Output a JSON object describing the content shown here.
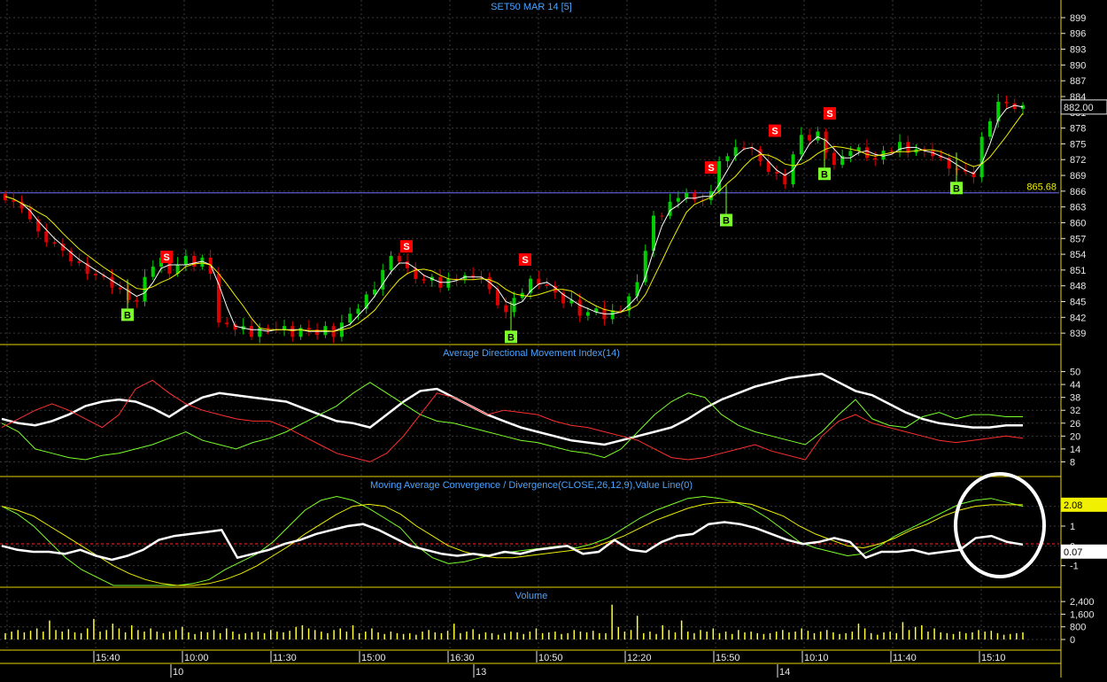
{
  "colors": {
    "background": "#000000",
    "grid": "#3a3a3a",
    "divider": "#e6d600",
    "axis_text": "#e8e8e8",
    "title_text": "#4aa3ff",
    "bull_candle": "#00d000",
    "bear_candle": "#e00000",
    "ma_white": "#ffffff",
    "ma_yellow": "#f0f000",
    "ref_line": "#6f6fff",
    "sell_marker": "#ff0000",
    "buy_marker": "#7cff2a",
    "zero_line": "#ff2a2a",
    "volume_bar": "#ffff33",
    "highlight_circle": "#ffffff"
  },
  "chart_data": [
    {
      "type": "candlestick",
      "title": "SET50 MAR 14   [5]",
      "ylim": [
        837,
        900
      ],
      "y_ticks": [
        "899",
        "896",
        "893",
        "890",
        "887",
        "884",
        "881",
        "878",
        "875",
        "872",
        "869",
        "866",
        "863",
        "860",
        "857",
        "854",
        "851",
        "848",
        "845",
        "842",
        "839"
      ],
      "last_price_label": "882.00",
      "reference_line": {
        "value": 865.68,
        "label": "865.68"
      },
      "series": [
        {
          "name": "price",
          "values": [
            865,
            864,
            862,
            861,
            858,
            857,
            856,
            854,
            853,
            852,
            851,
            850,
            849,
            848,
            847,
            846,
            845,
            849,
            852,
            853,
            851,
            852,
            853,
            852,
            853,
            851,
            841,
            840,
            840,
            840,
            839,
            840,
            839,
            840,
            840,
            839,
            840,
            839,
            839,
            840,
            839,
            841,
            842,
            844,
            846,
            848,
            851,
            853,
            853,
            851,
            850,
            849,
            849,
            848,
            849,
            850,
            850,
            849,
            850,
            847,
            845,
            843,
            845,
            847,
            849,
            849,
            848,
            846,
            845,
            845,
            843,
            843,
            843,
            842,
            843,
            844,
            846,
            848,
            855,
            861,
            862,
            864,
            864,
            866,
            864,
            865,
            866,
            871,
            873,
            874,
            875,
            874,
            871,
            870,
            869,
            868,
            873,
            876,
            876,
            877,
            874,
            871,
            872,
            874,
            874,
            873,
            872,
            873,
            874,
            875,
            874,
            874,
            873,
            873,
            872,
            871,
            870,
            869,
            869,
            876,
            880,
            883,
            882,
            882,
            882
          ]
        }
      ],
      "signals": [
        {
          "label": "B",
          "kind": "buy",
          "value": 842.5
        },
        {
          "label": "S",
          "kind": "sell",
          "value": 853.5
        },
        {
          "label": "S",
          "kind": "sell",
          "value": 855.5
        },
        {
          "label": "S",
          "kind": "sell",
          "value": 853.0
        },
        {
          "label": "B",
          "kind": "buy",
          "value": 838.3
        },
        {
          "label": "B",
          "kind": "buy",
          "value": 860.5
        },
        {
          "label": "S",
          "kind": "sell",
          "value": 870.5
        },
        {
          "label": "S",
          "kind": "sell",
          "value": 877.5
        },
        {
          "label": "S",
          "kind": "sell",
          "value": 880.8
        },
        {
          "label": "B",
          "kind": "buy",
          "value": 869.3
        },
        {
          "label": "B",
          "kind": "buy",
          "value": 866.6
        }
      ]
    },
    {
      "type": "line",
      "title": "Average Directional Movement Index(14)",
      "ylim": [
        2,
        56
      ],
      "y_ticks": [
        "50",
        "44",
        "38",
        "32",
        "26",
        "20",
        "14",
        "8"
      ],
      "series": [
        {
          "name": "ADX",
          "color": "#ffffff",
          "values": [
            28,
            26,
            25,
            27,
            30,
            34,
            36,
            37,
            36,
            33,
            29,
            34,
            38,
            40,
            39,
            38,
            37,
            36,
            33,
            30,
            27,
            26,
            24,
            30,
            36,
            41,
            42,
            38,
            34,
            30,
            27,
            24,
            22,
            20,
            18,
            17,
            16,
            18,
            20,
            22,
            24,
            28,
            33,
            37,
            40,
            43,
            45,
            47,
            48,
            49,
            45,
            41,
            39,
            35,
            31,
            28,
            26,
            25,
            24,
            24,
            25,
            25
          ]
        },
        {
          "name": "+DI",
          "color": "#7cff2a",
          "values": [
            26,
            22,
            14,
            12,
            10,
            9,
            11,
            12,
            14,
            16,
            19,
            22,
            18,
            16,
            14,
            17,
            19,
            22,
            26,
            30,
            34,
            40,
            45,
            40,
            35,
            30,
            27,
            26,
            24,
            22,
            20,
            18,
            17,
            15,
            13,
            12,
            10,
            14,
            22,
            30,
            36,
            40,
            38,
            30,
            25,
            22,
            20,
            18,
            16,
            22,
            30,
            37,
            28,
            25,
            24,
            29,
            31,
            28,
            30,
            30,
            29,
            29
          ]
        },
        {
          "name": "-DI",
          "color": "#ff3030",
          "values": [
            24,
            28,
            32,
            35,
            32,
            28,
            24,
            30,
            42,
            46,
            40,
            35,
            32,
            30,
            28,
            27,
            27,
            24,
            20,
            16,
            12,
            10,
            8,
            12,
            20,
            30,
            40,
            38,
            34,
            30,
            32,
            31,
            30,
            27,
            25,
            24,
            22,
            20,
            18,
            14,
            10,
            9,
            10,
            12,
            14,
            16,
            13,
            11,
            9,
            20,
            27,
            30,
            26,
            24,
            22,
            20,
            18,
            17,
            18,
            19,
            20,
            19
          ]
        }
      ]
    },
    {
      "type": "line",
      "title": "Moving Average Convergence / Divergence(CLOSE,26,12,9),Value Line(0)",
      "ylim": [
        -2,
        2.7
      ],
      "y_ticks": [
        "2",
        "1",
        "0",
        "-1"
      ],
      "labels": [
        "2.08",
        "0.07"
      ],
      "series": [
        {
          "name": "MACD",
          "color": "#7cff2a",
          "values": [
            2.0,
            1.6,
            1.0,
            0.2,
            -0.6,
            -1.2,
            -1.6,
            -2.0,
            -2.0,
            -2.0,
            -2.0,
            -2.0,
            -1.9,
            -1.7,
            -1.2,
            -0.8,
            -0.4,
            0.2,
            1.0,
            1.8,
            2.3,
            2.5,
            2.3,
            1.9,
            1.4,
            0.9,
            0.0,
            -0.6,
            -0.9,
            -0.8,
            -0.6,
            -0.4,
            -0.3,
            -0.2,
            -0.1,
            0.0,
            -0.1,
            0.1,
            0.4,
            0.9,
            1.4,
            1.8,
            2.1,
            2.4,
            2.5,
            2.4,
            2.2,
            1.9,
            1.4,
            0.8,
            0.2,
            -0.1,
            -0.3,
            -0.5,
            -0.4,
            0.0,
            0.5,
            0.9,
            1.3,
            1.7,
            2.1,
            2.3,
            2.4,
            2.2,
            2.0
          ]
        },
        {
          "name": "Signal",
          "color": "#f0f000",
          "values": [
            2.0,
            1.8,
            1.5,
            1.0,
            0.5,
            0.0,
            -0.5,
            -1.0,
            -1.4,
            -1.7,
            -1.9,
            -2.0,
            -2.0,
            -1.9,
            -1.7,
            -1.4,
            -1.0,
            -0.5,
            0.0,
            0.6,
            1.1,
            1.6,
            2.0,
            2.1,
            2.0,
            1.6,
            1.0,
            0.5,
            0.0,
            -0.3,
            -0.5,
            -0.6,
            -0.6,
            -0.5,
            -0.4,
            -0.3,
            -0.2,
            -0.1,
            0.2,
            0.5,
            0.9,
            1.3,
            1.6,
            1.9,
            2.1,
            2.2,
            2.2,
            2.1,
            1.8,
            1.5,
            1.0,
            0.6,
            0.3,
            0.0,
            -0.1,
            0.1,
            0.4,
            0.8,
            1.1,
            1.5,
            1.8,
            2.0,
            2.08,
            2.08,
            2.08
          ]
        },
        {
          "name": "Histogram",
          "color": "#ffffff",
          "values": [
            0.0,
            -0.2,
            -0.3,
            -0.3,
            -0.4,
            -0.2,
            -0.5,
            -0.7,
            -0.5,
            -0.2,
            0.3,
            0.5,
            0.6,
            0.7,
            0.8,
            -0.6,
            -0.4,
            -0.2,
            0.1,
            0.3,
            0.6,
            0.8,
            1.0,
            1.1,
            0.8,
            0.4,
            0.0,
            -0.2,
            -0.4,
            -0.5,
            -0.4,
            -0.5,
            -0.3,
            -0.4,
            -0.2,
            -0.1,
            0.0,
            -0.4,
            -0.3,
            0.3,
            -0.2,
            -0.3,
            0.2,
            0.5,
            0.6,
            1.1,
            1.2,
            1.1,
            0.9,
            0.6,
            0.3,
            0.1,
            0.2,
            0.4,
            0.2,
            -0.6,
            -0.3,
            -0.3,
            -0.2,
            -0.4,
            -0.3,
            -0.2,
            0.4,
            0.5,
            0.2,
            0.07
          ]
        }
      ]
    },
    {
      "type": "bar",
      "title": "Volume",
      "ylim": [
        0,
        2800
      ],
      "y_ticks": [
        "2,400",
        "1,600",
        "800",
        "0"
      ],
      "values": [
        400,
        500,
        600,
        450,
        550,
        700,
        500,
        1200,
        600,
        500,
        650,
        450,
        400,
        700,
        1300,
        500,
        600,
        1000,
        700,
        450,
        900,
        600,
        500,
        700,
        500,
        400,
        500,
        600,
        800,
        450,
        350,
        500,
        450,
        600,
        400,
        700,
        500,
        350,
        400,
        450,
        500,
        400,
        600,
        500,
        450,
        550,
        800,
        900,
        700,
        600,
        500,
        400,
        600,
        700,
        500,
        900,
        400,
        500,
        700,
        450,
        350,
        500,
        400,
        350,
        400,
        300,
        500,
        600,
        450,
        400,
        550,
        1000,
        400,
        500,
        650,
        350,
        450,
        400,
        300,
        400,
        500,
        450,
        350,
        500,
        700,
        400,
        450,
        500,
        350,
        400,
        600,
        500,
        450,
        550,
        400,
        400,
        2200,
        800,
        500,
        600,
        1500,
        400,
        500,
        350,
        900,
        600,
        450,
        1200,
        500,
        400,
        600,
        500,
        700,
        400,
        500,
        350,
        600,
        450,
        500,
        400,
        350,
        400,
        500,
        600,
        450,
        500,
        700,
        550,
        400,
        500,
        600,
        450,
        350,
        400,
        500,
        1000,
        700,
        400,
        300,
        450,
        500,
        400,
        1100,
        600,
        800,
        900,
        500,
        700,
        450,
        400,
        350,
        500,
        400,
        450,
        600,
        500,
        550,
        400,
        300,
        350,
        400,
        450
      ]
    }
  ],
  "x_axis": {
    "time_labels": [
      "15:40",
      "10:00",
      "11:30",
      "15:00",
      "16:30",
      "10:50",
      "12:20",
      "15:50",
      "10:10",
      "11:40",
      "15:10"
    ],
    "day_labels": [
      "10",
      "13",
      "14"
    ]
  }
}
